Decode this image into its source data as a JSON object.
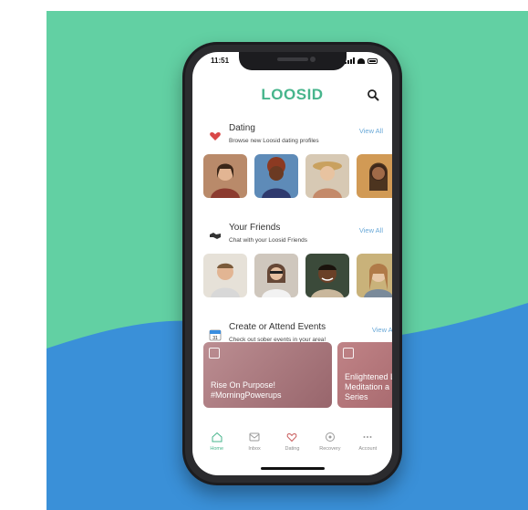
{
  "colors": {
    "brand": "#47b58c",
    "mint_bg": "#62d0a3",
    "blue_bg": "#3a90d8",
    "link": "#6aa9d8",
    "card": "#b07a7f"
  },
  "status_bar": {
    "time": "11:51"
  },
  "app": {
    "logo": "LOOSID",
    "search_icon": "search-icon"
  },
  "sections": {
    "dating": {
      "title": "Dating",
      "subtitle": "Browse new Loosid dating profiles",
      "view_all": "View All",
      "icon": "heart-icon"
    },
    "friends": {
      "title": "Your Friends",
      "subtitle": "Chat with your Loosid Friends",
      "view_all": "View All",
      "icon": "handshake-icon"
    },
    "events": {
      "title": "Create or Attend Events",
      "subtitle": "Check out sober events in your area!",
      "view_all": "View All",
      "icon": "calendar-icon",
      "calendar_day": "31"
    }
  },
  "event_cards": [
    {
      "line1": "Rise On Purpose!",
      "line2": "#MorningPowerups"
    },
    {
      "line1": "Enlightened Li",
      "line2": "Meditation a",
      "line3": "Series"
    }
  ],
  "tabs": [
    {
      "label": "Home",
      "icon": "home-icon",
      "active": true
    },
    {
      "label": "Inbox",
      "icon": "inbox-icon",
      "active": false
    },
    {
      "label": "Dating",
      "icon": "heart-outline-icon",
      "active": false
    },
    {
      "label": "Recovery",
      "icon": "recovery-icon",
      "active": false
    },
    {
      "label": "Account",
      "icon": "more-icon",
      "active": false
    }
  ]
}
